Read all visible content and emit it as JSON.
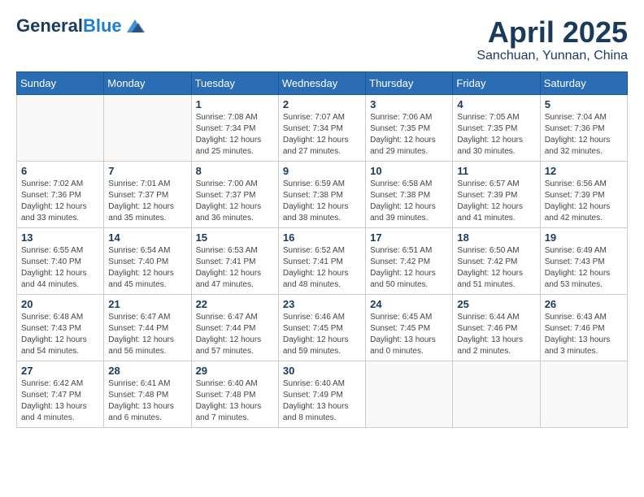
{
  "header": {
    "logo_line1": "General",
    "logo_line2": "Blue",
    "title": "April 2025",
    "location": "Sanchuan, Yunnan, China"
  },
  "weekdays": [
    "Sunday",
    "Monday",
    "Tuesday",
    "Wednesday",
    "Thursday",
    "Friday",
    "Saturday"
  ],
  "weeks": [
    [
      {
        "day": "",
        "info": ""
      },
      {
        "day": "",
        "info": ""
      },
      {
        "day": "1",
        "info": "Sunrise: 7:08 AM\nSunset: 7:34 PM\nDaylight: 12 hours\nand 25 minutes."
      },
      {
        "day": "2",
        "info": "Sunrise: 7:07 AM\nSunset: 7:34 PM\nDaylight: 12 hours\nand 27 minutes."
      },
      {
        "day": "3",
        "info": "Sunrise: 7:06 AM\nSunset: 7:35 PM\nDaylight: 12 hours\nand 29 minutes."
      },
      {
        "day": "4",
        "info": "Sunrise: 7:05 AM\nSunset: 7:35 PM\nDaylight: 12 hours\nand 30 minutes."
      },
      {
        "day": "5",
        "info": "Sunrise: 7:04 AM\nSunset: 7:36 PM\nDaylight: 12 hours\nand 32 minutes."
      }
    ],
    [
      {
        "day": "6",
        "info": "Sunrise: 7:02 AM\nSunset: 7:36 PM\nDaylight: 12 hours\nand 33 minutes."
      },
      {
        "day": "7",
        "info": "Sunrise: 7:01 AM\nSunset: 7:37 PM\nDaylight: 12 hours\nand 35 minutes."
      },
      {
        "day": "8",
        "info": "Sunrise: 7:00 AM\nSunset: 7:37 PM\nDaylight: 12 hours\nand 36 minutes."
      },
      {
        "day": "9",
        "info": "Sunrise: 6:59 AM\nSunset: 7:38 PM\nDaylight: 12 hours\nand 38 minutes."
      },
      {
        "day": "10",
        "info": "Sunrise: 6:58 AM\nSunset: 7:38 PM\nDaylight: 12 hours\nand 39 minutes."
      },
      {
        "day": "11",
        "info": "Sunrise: 6:57 AM\nSunset: 7:39 PM\nDaylight: 12 hours\nand 41 minutes."
      },
      {
        "day": "12",
        "info": "Sunrise: 6:56 AM\nSunset: 7:39 PM\nDaylight: 12 hours\nand 42 minutes."
      }
    ],
    [
      {
        "day": "13",
        "info": "Sunrise: 6:55 AM\nSunset: 7:40 PM\nDaylight: 12 hours\nand 44 minutes."
      },
      {
        "day": "14",
        "info": "Sunrise: 6:54 AM\nSunset: 7:40 PM\nDaylight: 12 hours\nand 45 minutes."
      },
      {
        "day": "15",
        "info": "Sunrise: 6:53 AM\nSunset: 7:41 PM\nDaylight: 12 hours\nand 47 minutes."
      },
      {
        "day": "16",
        "info": "Sunrise: 6:52 AM\nSunset: 7:41 PM\nDaylight: 12 hours\nand 48 minutes."
      },
      {
        "day": "17",
        "info": "Sunrise: 6:51 AM\nSunset: 7:42 PM\nDaylight: 12 hours\nand 50 minutes."
      },
      {
        "day": "18",
        "info": "Sunrise: 6:50 AM\nSunset: 7:42 PM\nDaylight: 12 hours\nand 51 minutes."
      },
      {
        "day": "19",
        "info": "Sunrise: 6:49 AM\nSunset: 7:43 PM\nDaylight: 12 hours\nand 53 minutes."
      }
    ],
    [
      {
        "day": "20",
        "info": "Sunrise: 6:48 AM\nSunset: 7:43 PM\nDaylight: 12 hours\nand 54 minutes."
      },
      {
        "day": "21",
        "info": "Sunrise: 6:47 AM\nSunset: 7:44 PM\nDaylight: 12 hours\nand 56 minutes."
      },
      {
        "day": "22",
        "info": "Sunrise: 6:47 AM\nSunset: 7:44 PM\nDaylight: 12 hours\nand 57 minutes."
      },
      {
        "day": "23",
        "info": "Sunrise: 6:46 AM\nSunset: 7:45 PM\nDaylight: 12 hours\nand 59 minutes."
      },
      {
        "day": "24",
        "info": "Sunrise: 6:45 AM\nSunset: 7:45 PM\nDaylight: 13 hours\nand 0 minutes."
      },
      {
        "day": "25",
        "info": "Sunrise: 6:44 AM\nSunset: 7:46 PM\nDaylight: 13 hours\nand 2 minutes."
      },
      {
        "day": "26",
        "info": "Sunrise: 6:43 AM\nSunset: 7:46 PM\nDaylight: 13 hours\nand 3 minutes."
      }
    ],
    [
      {
        "day": "27",
        "info": "Sunrise: 6:42 AM\nSunset: 7:47 PM\nDaylight: 13 hours\nand 4 minutes."
      },
      {
        "day": "28",
        "info": "Sunrise: 6:41 AM\nSunset: 7:48 PM\nDaylight: 13 hours\nand 6 minutes."
      },
      {
        "day": "29",
        "info": "Sunrise: 6:40 AM\nSunset: 7:48 PM\nDaylight: 13 hours\nand 7 minutes."
      },
      {
        "day": "30",
        "info": "Sunrise: 6:40 AM\nSunset: 7:49 PM\nDaylight: 13 hours\nand 8 minutes."
      },
      {
        "day": "",
        "info": ""
      },
      {
        "day": "",
        "info": ""
      },
      {
        "day": "",
        "info": ""
      }
    ]
  ]
}
